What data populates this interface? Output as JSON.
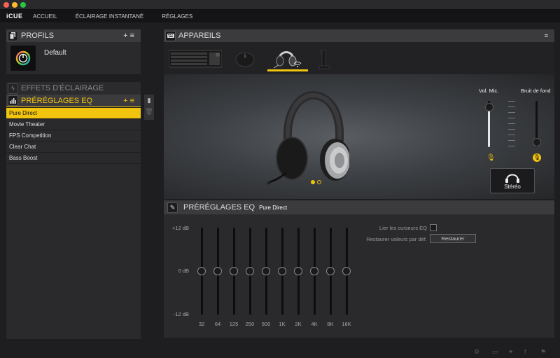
{
  "app": {
    "logo": "iCUE"
  },
  "nav": {
    "home": "ACCUEIL",
    "instant_lighting": "ÉCLAIRAGE INSTANTANÉ",
    "settings": "RÉGLAGES"
  },
  "profiles": {
    "title": "PROFILS",
    "active_profile": "Default"
  },
  "lighting_effects": {
    "title": "EFFETS D'ÉCLAIRAGE"
  },
  "eq_presets": {
    "title": "PRÉRÉGLAGES EQ",
    "items": [
      "Pure Direct",
      "Movie Theater",
      "FPS Competition",
      "Clear Chat",
      "Bass Boost"
    ],
    "selected": "Pure Direct"
  },
  "devices": {
    "title": "APPAREILS",
    "list": [
      "keyboard",
      "mouse",
      "headset",
      "headset-stand"
    ],
    "selected": "headset"
  },
  "audio": {
    "mic_volume_label": "Vol. Mic.",
    "sidetone_label": "Bruit de fond",
    "mic_volume_level": 0.95,
    "sidetone_level": 0.02,
    "stereo_label": "Stéréo"
  },
  "eq": {
    "title": "PRÉRÉGLAGES EQ",
    "preset_name": "Pure Direct",
    "db_max": "+12 dB",
    "db_zero": "0 dB",
    "db_min": "-12 dB",
    "bands": [
      "32",
      "64",
      "125",
      "250",
      "500",
      "1K",
      "2K",
      "4K",
      "8K",
      "16K"
    ],
    "band_values_db": [
      0,
      0,
      0,
      0,
      0,
      0,
      0,
      0,
      0,
      0
    ],
    "link_sliders_label": "Lier les curseurs EQ",
    "restore_defaults_label": "Restaurer valeurs par déf.",
    "restore_button": "Restaurer"
  },
  "colors": {
    "accent": "#f1c40f"
  }
}
